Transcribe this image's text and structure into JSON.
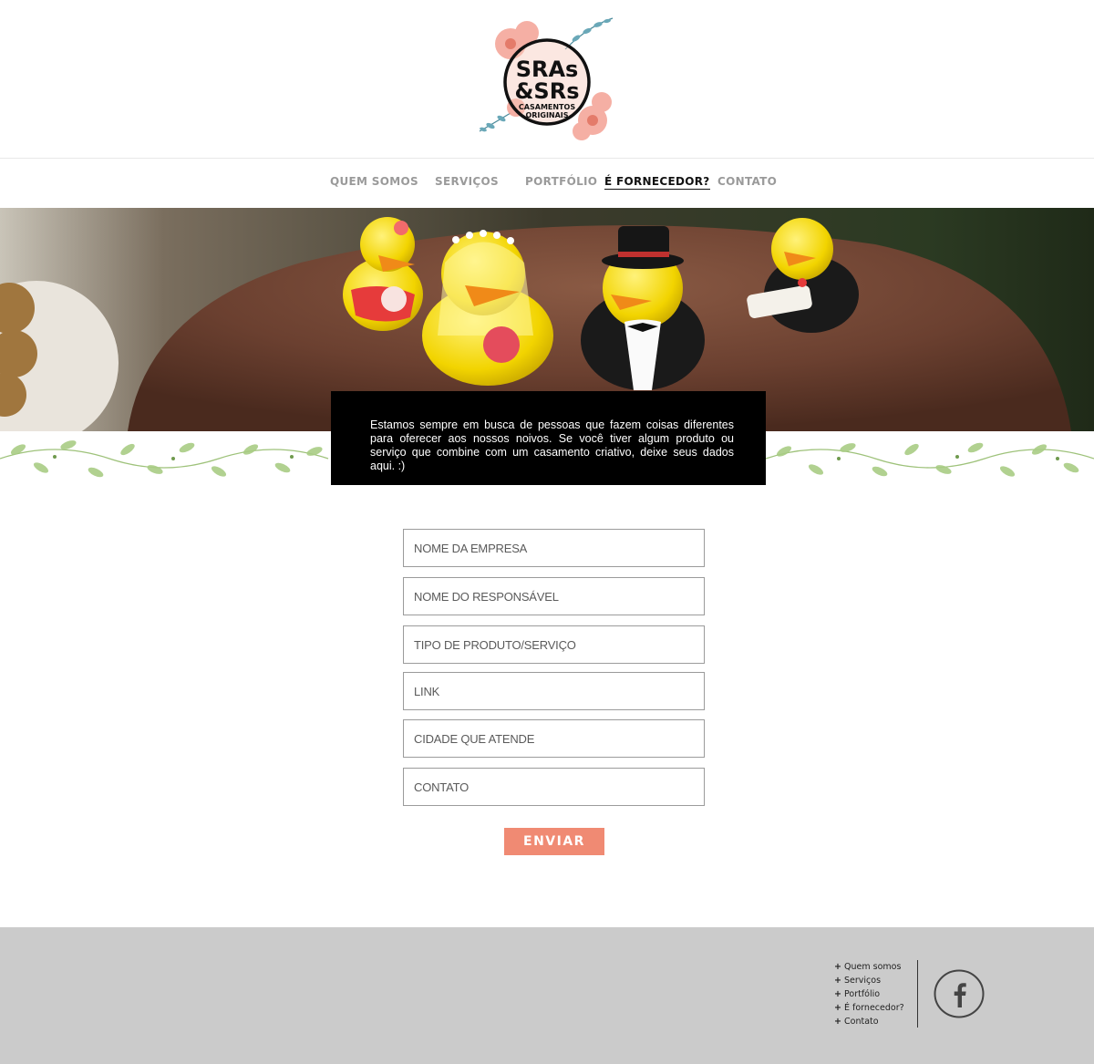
{
  "logo": {
    "line1": "SRAs",
    "line2": "&SRs",
    "line3": "CASAMENTOS",
    "line4": "ORIGINAIS"
  },
  "nav": {
    "items": [
      {
        "label": "QUEM SOMOS"
      },
      {
        "label": "SERVIÇOS"
      },
      {
        "label": "PORTFÓLIO"
      },
      {
        "label": "É FORNECEDOR?"
      },
      {
        "label": "CONTATO"
      }
    ],
    "active_index": 3
  },
  "intro": {
    "text": "Estamos sempre em busca de pessoas que fazem coisas diferentes para oferecer aos nossos noivos. Se você tiver algum produto ou serviço que combine com um casamento criativo, deixe seus dados aqui. :)"
  },
  "form": {
    "company_placeholder": "NOME DA EMPRESA",
    "responsible_placeholder": "NOME DO RESPONSÁVEL",
    "product_placeholder": "TIPO DE PRODUTO/SERVIÇO",
    "link_placeholder": "LINK",
    "city_placeholder": "CIDADE QUE ATENDE",
    "contact_placeholder": "CONTATO",
    "submit_label": "ENVIAR"
  },
  "footer": {
    "links": [
      "Quem somos",
      "Serviços",
      "Portfólio",
      "É fornecedor?",
      "Contato"
    ],
    "plus": "+",
    "social_icon": "facebook-icon"
  },
  "colors": {
    "accent": "#f08a73",
    "footer_bg": "#cbcbcb",
    "intro_bg": "#000000"
  }
}
